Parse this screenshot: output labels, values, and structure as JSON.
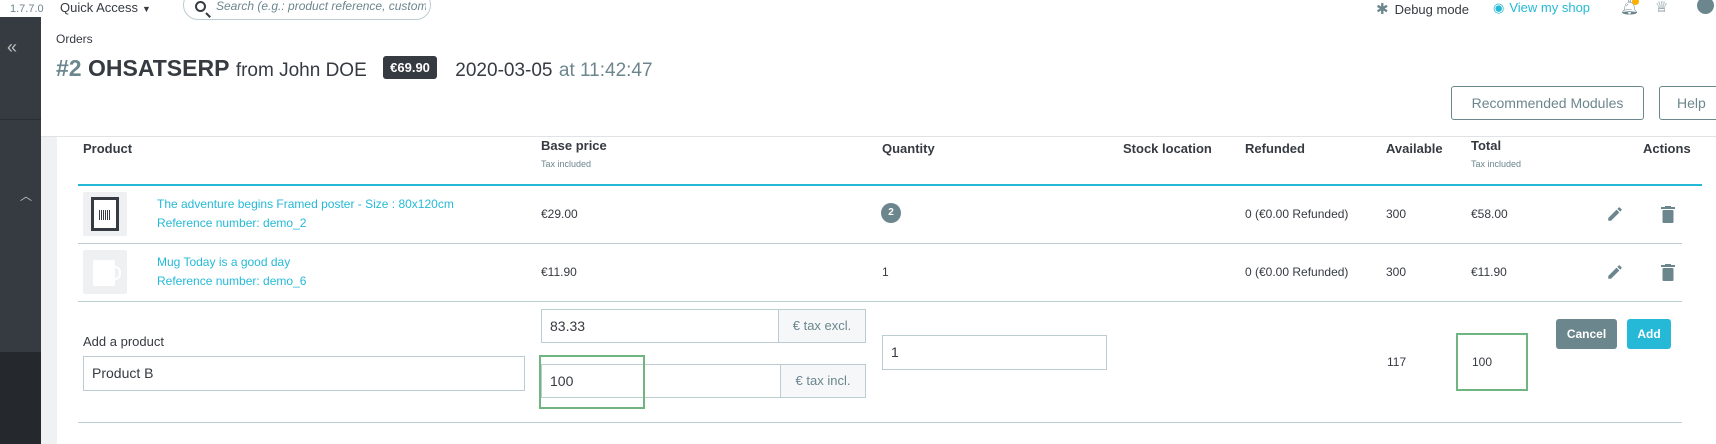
{
  "topbar": {
    "version": "1.7.7.0",
    "quick_access": "Quick Access",
    "search_placeholder": "Search (e.g.: product reference, custome",
    "debug_mode": "Debug mode",
    "view_shop": "View my shop"
  },
  "header": {
    "breadcrumb": "Orders",
    "order_number": "#2",
    "order_reference": "OHSATSERP",
    "from_text": "from John DOE",
    "total_badge": "€69.90",
    "date": "2020-03-05",
    "time": "at 11:42:47",
    "recommended_modules": "Recommended Modules",
    "help": "Help"
  },
  "table": {
    "headers": {
      "product": "Product",
      "base_price": "Base price",
      "base_price_sub": "Tax included",
      "quantity": "Quantity",
      "stock_location": "Stock location",
      "refunded": "Refunded",
      "available": "Available",
      "total": "Total",
      "total_sub": "Tax included",
      "actions": "Actions"
    },
    "rows": [
      {
        "name": "The adventure begins Framed poster - Size : 80x120cm",
        "reference": "Reference number: demo_2",
        "base_price": "€29.00",
        "quantity": "2",
        "refunded": "0 (€0.00 Refunded)",
        "available": "300",
        "total": "€58.00"
      },
      {
        "name": "Mug Today is a good day",
        "reference": "Reference number: demo_6",
        "base_price": "€11.90",
        "quantity": "1",
        "refunded": "0 (€0.00 Refunded)",
        "available": "300",
        "total": "€11.90"
      }
    ]
  },
  "add_product": {
    "label": "Add a product",
    "product_value": "Product B",
    "price_excl_value": "83.33",
    "price_excl_addon": "€ tax excl.",
    "price_incl_value": "100",
    "price_incl_addon": "€ tax incl.",
    "quantity_value": "1",
    "available": "117",
    "total": "100",
    "cancel_label": "Cancel",
    "add_label": "Add"
  },
  "colors": {
    "primary": "#25b9d7",
    "dark": "#363a41",
    "muted": "#6c868e",
    "highlight_green": "#70b580"
  }
}
